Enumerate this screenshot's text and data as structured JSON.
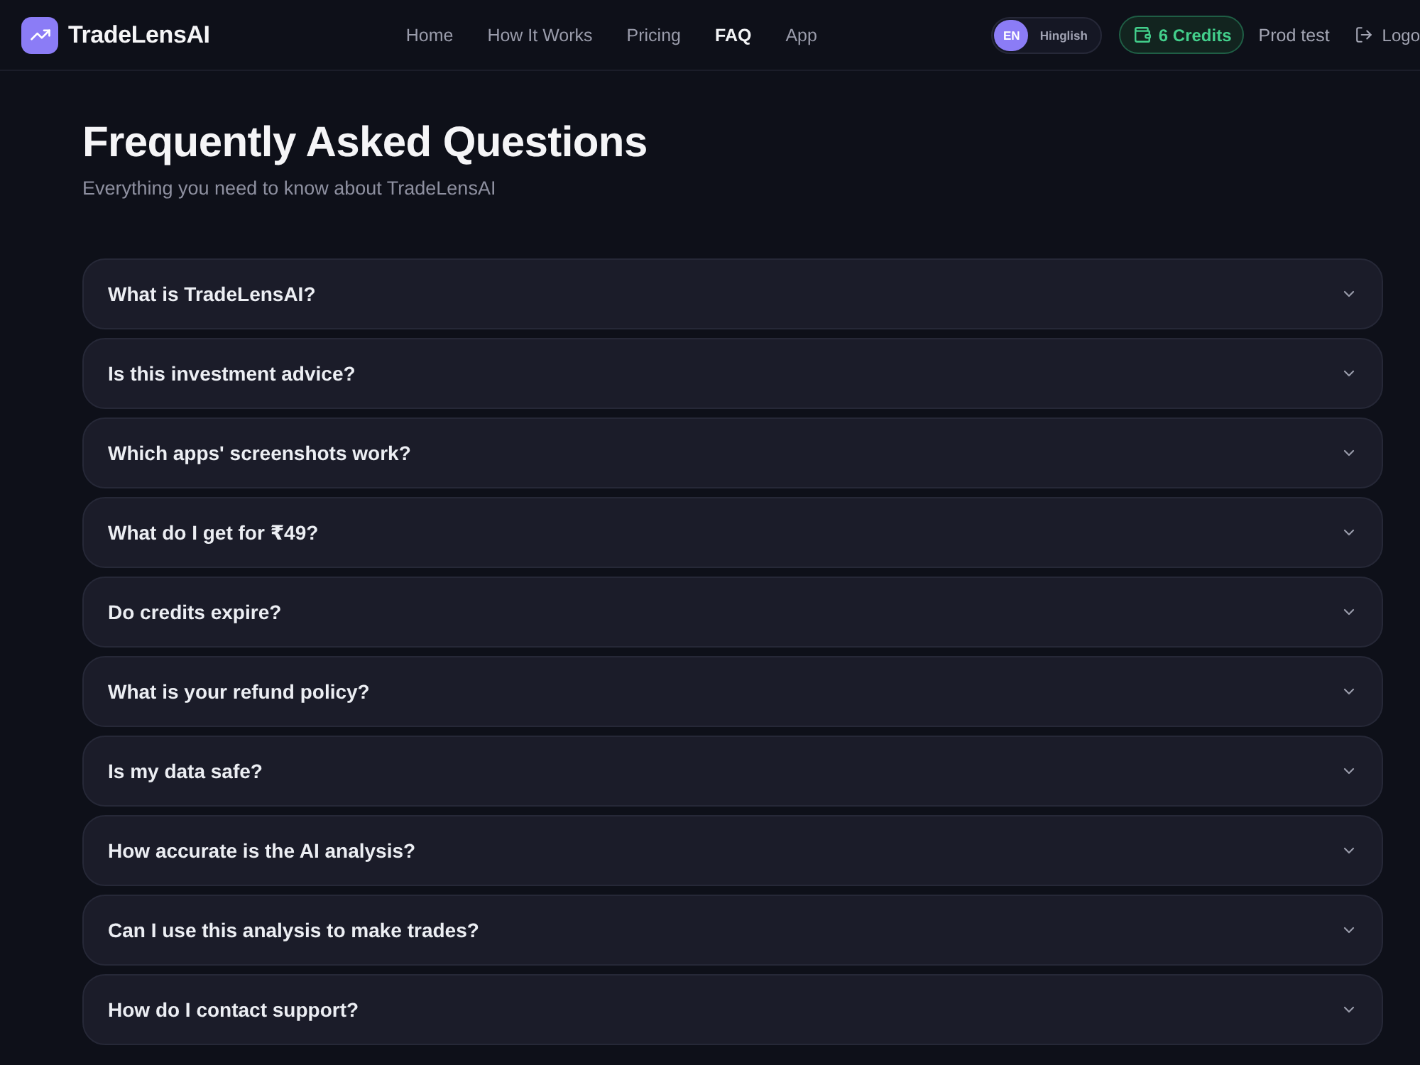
{
  "header": {
    "brand": "TradeLensAI",
    "nav": [
      {
        "label": "Home",
        "selected": false
      },
      {
        "label": "How It Works",
        "selected": false
      },
      {
        "label": "Pricing",
        "selected": false
      },
      {
        "label": "FAQ",
        "selected": true
      },
      {
        "label": "App",
        "selected": false
      }
    ],
    "language_toggle": [
      {
        "label": "EN",
        "selected": true
      },
      {
        "label": "Hinglish",
        "selected": false
      }
    ],
    "credits": "6 Credits",
    "user": "Prod test",
    "logout": "Logo"
  },
  "hero": {
    "title": "Frequently Asked Questions",
    "subtitle": "Everything you need to know about TradeLensAI"
  },
  "faq": [
    {
      "question": "What is TradeLensAI?",
      "expanded": false
    },
    {
      "question": "Is this investment advice?",
      "expanded": false
    },
    {
      "question": "Which apps' screenshots work?",
      "expanded": false
    },
    {
      "question": "What do I get for ₹49?",
      "expanded": false
    },
    {
      "question": "Do credits expire?",
      "expanded": false
    },
    {
      "question": "What is your refund policy?",
      "expanded": false
    },
    {
      "question": "Is my data safe?",
      "expanded": false
    },
    {
      "question": "How accurate is the AI analysis?",
      "expanded": false
    },
    {
      "question": "Can I use this analysis to make trades?",
      "expanded": false
    },
    {
      "question": "How do I contact support?",
      "expanded": false
    }
  ]
}
